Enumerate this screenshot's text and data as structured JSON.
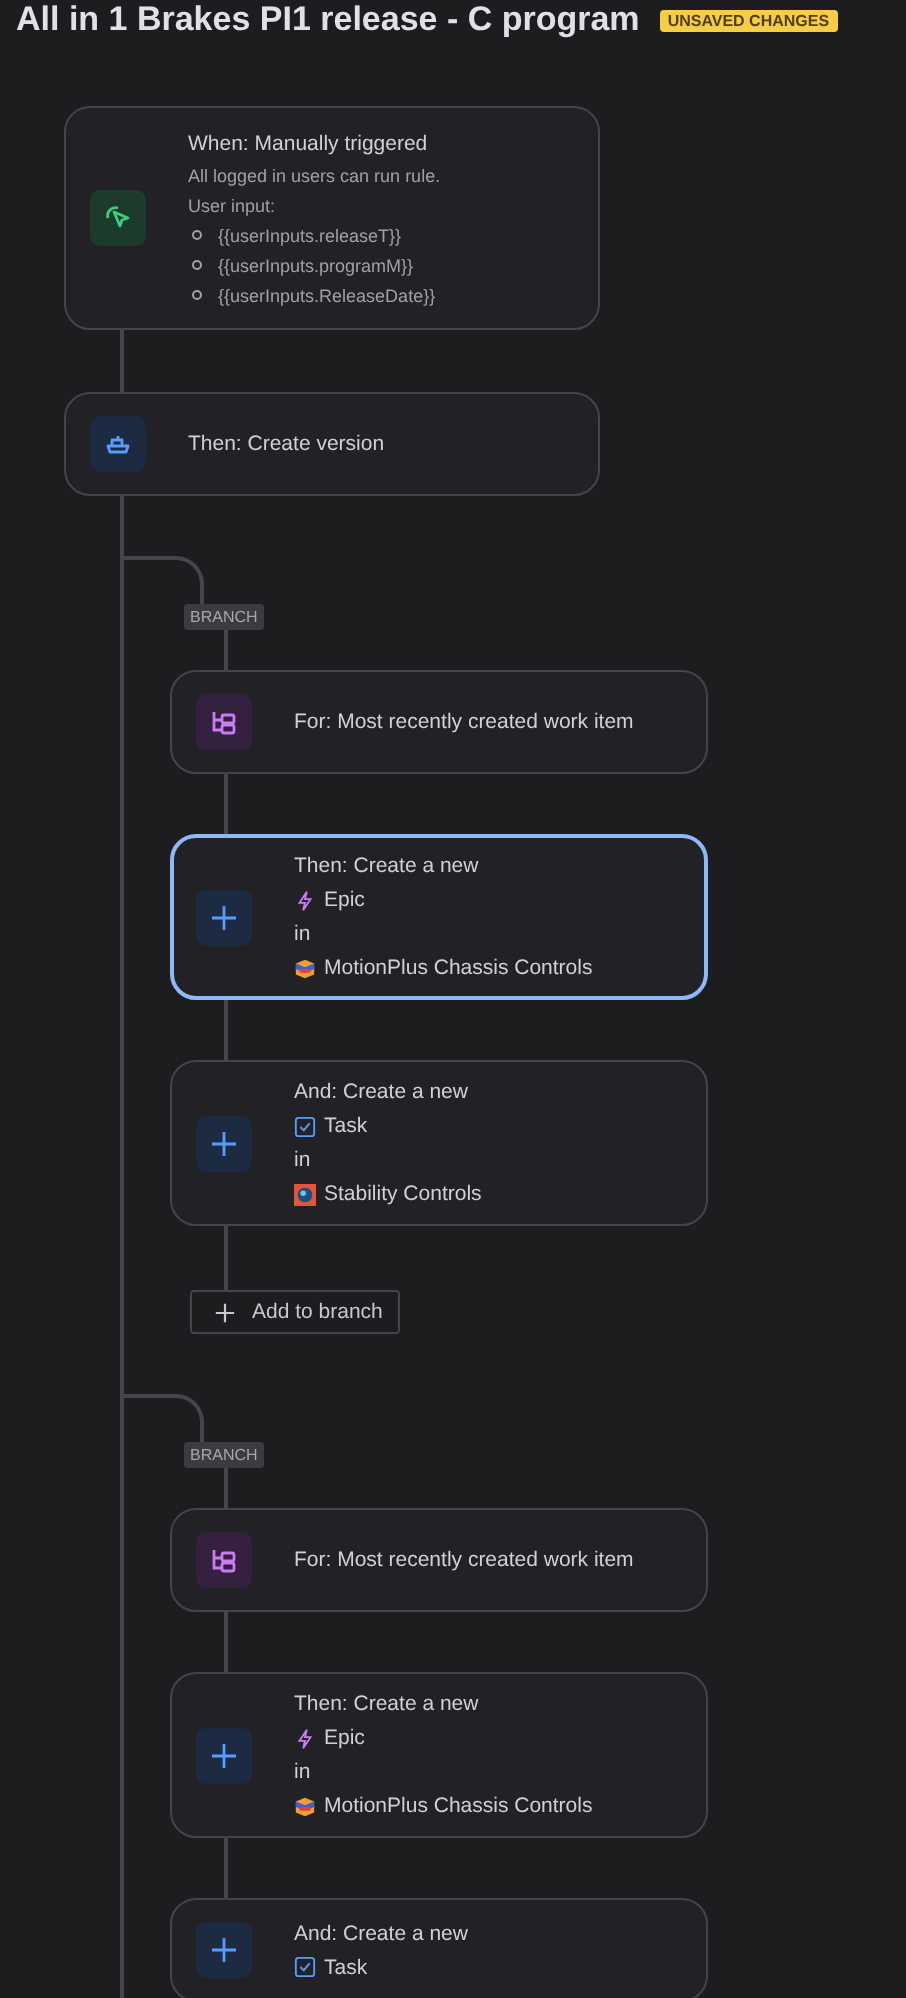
{
  "title": "All in 1 Brakes PI1 release - C program",
  "status_badge": "UNSAVED CHANGES",
  "trigger": {
    "kind": "trigger",
    "title": "When: Manually triggered",
    "description": "All logged in users can run rule.",
    "input_label": "User input:",
    "inputs": [
      "{{userInputs.releaseT}}",
      "{{userInputs.programM}}",
      "{{userInputs.ReleaseDate}}"
    ]
  },
  "steps": [
    {
      "kind": "version",
      "title": "Then: Create version"
    }
  ],
  "branches": [
    {
      "label": "BRANCH",
      "add_button": "Add to branch",
      "items": [
        {
          "kind": "for",
          "title": "For: Most recently created work item",
          "selected": false
        },
        {
          "kind": "create",
          "title": "Then: Create a new",
          "work_type": {
            "kind": "epic",
            "label": "Epic"
          },
          "preposition": "in",
          "project": {
            "kind": "motion",
            "label": "MotionPlus Chassis Controls"
          },
          "selected": true
        },
        {
          "kind": "create",
          "title": "And: Create a new",
          "work_type": {
            "kind": "task",
            "label": "Task"
          },
          "preposition": "in",
          "project": {
            "kind": "stability",
            "label": "Stability Controls"
          },
          "selected": false
        }
      ]
    },
    {
      "label": "BRANCH",
      "items": [
        {
          "kind": "for",
          "title": "For: Most recently created work item",
          "selected": false
        },
        {
          "kind": "create",
          "title": "Then: Create a new",
          "work_type": {
            "kind": "epic",
            "label": "Epic"
          },
          "preposition": "in",
          "project": {
            "kind": "motion",
            "label": "MotionPlus Chassis Controls"
          },
          "selected": false
        },
        {
          "kind": "create",
          "title": "And: Create a new",
          "work_type": {
            "kind": "task",
            "label": "Task"
          },
          "selected": false
        }
      ]
    }
  ]
}
